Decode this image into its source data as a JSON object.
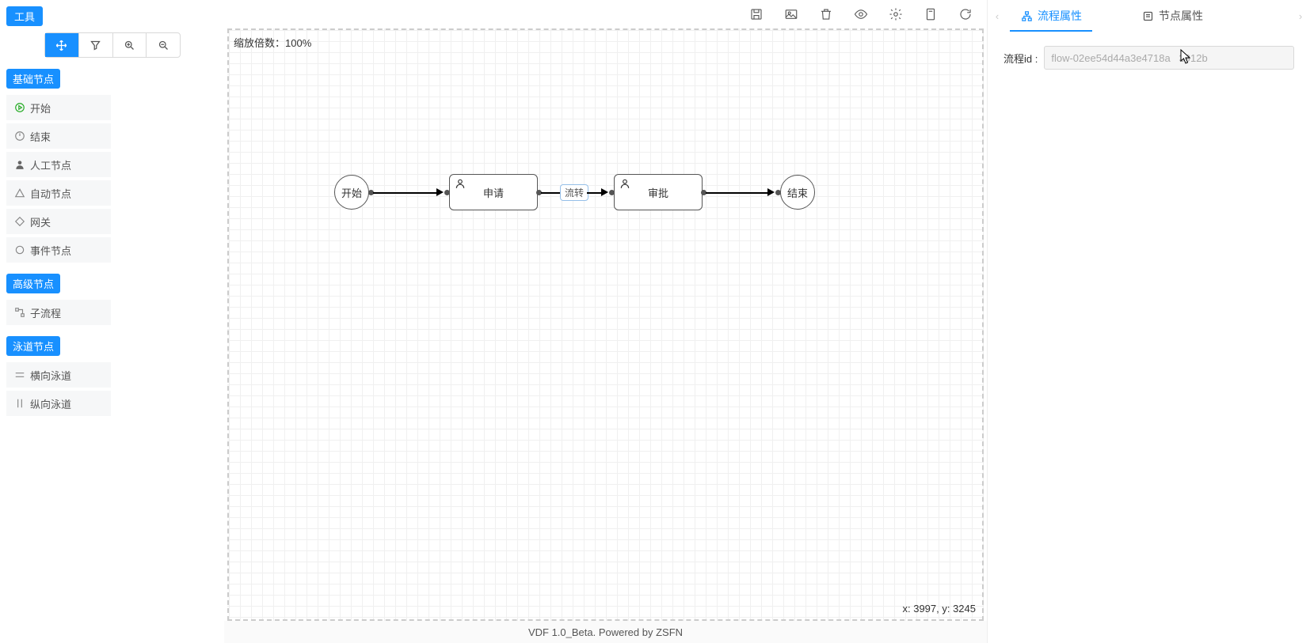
{
  "sidebar": {
    "title": "工具",
    "sections": {
      "basic": {
        "label": "基础节点",
        "items": [
          "开始",
          "结束",
          "人工节点",
          "自动节点",
          "网关",
          "事件节点"
        ]
      },
      "advanced": {
        "label": "高级节点",
        "items": [
          "子流程"
        ]
      },
      "lane": {
        "label": "泳道节点",
        "items": [
          "横向泳道",
          "纵向泳道"
        ]
      }
    }
  },
  "canvas": {
    "zoom_prefix": "缩放倍数：",
    "zoom_value": "100%",
    "coords": "x: 3997, y: 3245",
    "nodes": {
      "start": "开始",
      "task1": "申请",
      "edgeLabel": "流转",
      "task2": "审批",
      "end": "结束"
    }
  },
  "footer": "VDF 1.0_Beta. Powered by ZSFN",
  "right": {
    "tabs": {
      "flow": "流程属性",
      "node": "节点属性"
    },
    "form": {
      "flowid_label": "流程id :",
      "flowid_value": "flow-02ee54d44a3e4718a   3912b"
    }
  }
}
